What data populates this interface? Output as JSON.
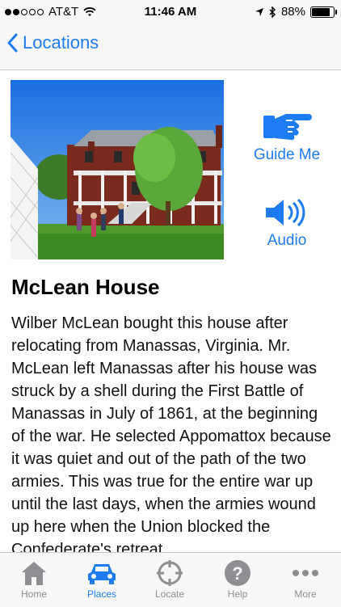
{
  "status_bar": {
    "carrier": "AT&T",
    "time": "11:46 AM",
    "battery": "88%",
    "battery_level": 0.88
  },
  "nav": {
    "back_label": "Locations"
  },
  "actions": {
    "guide_label": "Guide Me",
    "audio_label": "Audio"
  },
  "location": {
    "title": "McLean House",
    "description": "Wilber McLean bought this house after relocating from Manassas, Virginia. Mr. McLean left Manassas after his house was struck by a shell during the First Battle of Manassas in July of 1861, at the beginning of the war. He selected Appomattox because it was quiet and out of the path of the two armies. This was true for the entire war up until the last days, when the armies wound up here when the Union blocked the Confederate's retreat."
  },
  "tabs": [
    {
      "label": "Home",
      "icon": "house-icon"
    },
    {
      "label": "Places",
      "icon": "car-icon",
      "active": true
    },
    {
      "label": "Locate",
      "icon": "crosshair-icon"
    },
    {
      "label": "Help",
      "icon": "question-icon"
    },
    {
      "label": "More",
      "icon": "ellipsis-icon"
    }
  ],
  "colors": {
    "accent": "#1e7cf2",
    "inactive": "#8e8e93"
  }
}
